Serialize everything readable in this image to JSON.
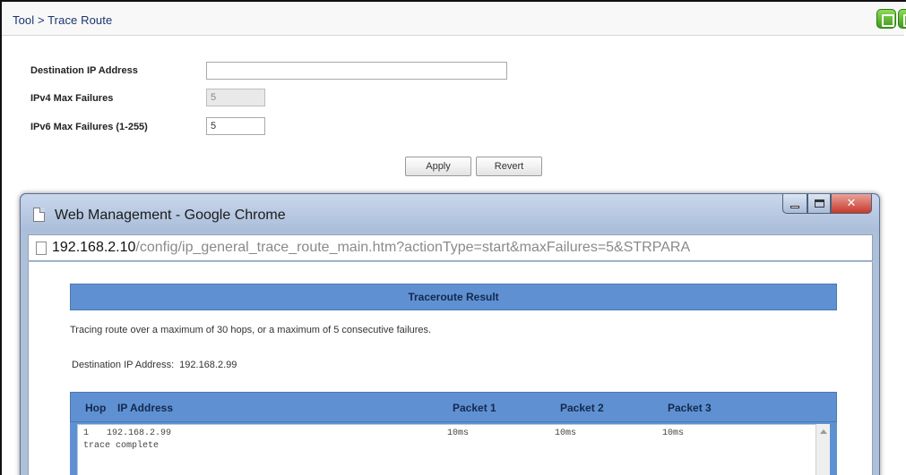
{
  "header": {
    "breadcrumb": "Tool > Trace Route"
  },
  "form": {
    "dest_label": "Destination IP Address",
    "dest_value": "",
    "ipv4_label": "IPv4 Max Failures",
    "ipv4_value": "5",
    "ipv6_label": "IPv6 Max Failures (1-255)",
    "ipv6_value": "5",
    "apply_label": "Apply",
    "revert_label": "Revert"
  },
  "popup": {
    "title": "Web Management - Google Chrome",
    "url_host": "192.168.2.10",
    "url_path": "/config/ip_general_trace_route_main.htm?actionType=start&maxFailures=5&STRPARA",
    "result_title": "Traceroute Result",
    "tracing_text": "Tracing route over a maximum of 30 hops, or a maximum of 5 consecutive failures.",
    "dest_label": "Destination IP Address:",
    "dest_value": "192.168.2.99",
    "table": {
      "headers": {
        "hop": "Hop",
        "ip": "IP Address",
        "p1": "Packet 1",
        "p2": "Packet 2",
        "p3": "Packet 3"
      },
      "rows": [
        {
          "hop": "1",
          "ip": "192.168.2.99",
          "p1": "10ms",
          "p2": "10ms",
          "p3": "10ms"
        }
      ],
      "footer_text": "trace complete"
    }
  }
}
